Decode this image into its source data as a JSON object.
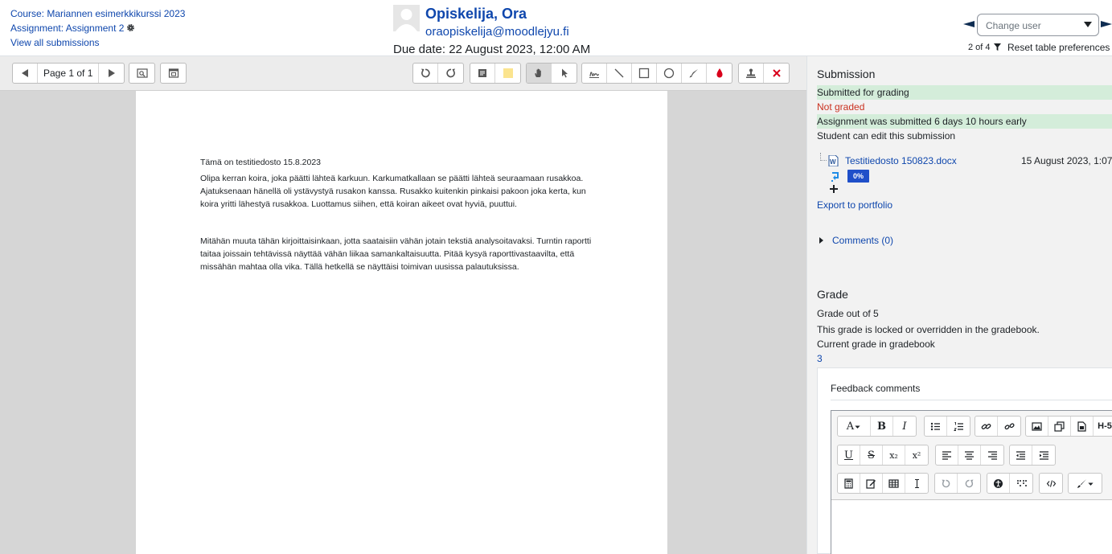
{
  "header": {
    "course": "Course: Mariannen esimerkkikurssi 2023",
    "assignment": "Assignment: Assignment 2",
    "view_all": "View all submissions",
    "user_name": "Opiskelija, Ora",
    "user_email": "oraopiskelija@moodlejyu.fi",
    "due_date": "Due date: 22 August 2023, 12:00 AM",
    "change_user_placeholder": "Change user",
    "user_count": "2 of 4",
    "reset_prefs": "Reset table preferences"
  },
  "toolbar": {
    "page_label": "Page 1 of 1",
    "icons": [
      "previous-page",
      "next-page",
      "search-comments",
      "expand-comments",
      "rotate-left",
      "rotate-right",
      "comment",
      "comment-color",
      "pan",
      "select",
      "pen",
      "line",
      "rectangle",
      "oval",
      "highlight",
      "annotation-color",
      "stamp",
      "delete"
    ]
  },
  "document": {
    "title": "Tämä on testitiedosto 15.8.2023",
    "paragraphs": [
      "Olipa kerran koira, joka päätti lähteä karkuun. Karkumatkallaan se päätti lähteä seuraamaan rusakkoa. Ajatuksenaan hänellä oli ystävystyä rusakon kanssa.  Rusakko kuitenkin pinkaisi pakoon joka kerta, kun koira yritti lähestyä rusakkoa. Luottamus siihen, että koiran aikeet ovat hyviä, puuttui.",
      "Mitähän muuta tähän kirjoittaisinkaan, jotta saataisiin vähän jotain tekstiä analysoitavaksi. Turntin raportti taitaa joissain tehtävissä näyttää vähän liikaa samankaltaisuutta. Pitää kysyä raporttivastaavilta, että missähän mahtaa olla vika. Tällä hetkellä se näyttäisi toimivan uusissa palautuksissa."
    ]
  },
  "submission": {
    "title": "Submission",
    "status_submitted": "Submitted for grading",
    "status_grading": "Not graded",
    "status_time": "Assignment was submitted 6 days 10 hours early",
    "status_edit": "Student can edit this submission",
    "file_name": "Testitiedosto 150823.docx",
    "file_date": "15 August 2023, 1:07",
    "similarity": "0%",
    "export": "Export to portfolio",
    "comments": "Comments (0)"
  },
  "grade": {
    "title": "Grade",
    "out_of": "Grade out of 5",
    "locked": "This grade is locked or overridden in the gradebook.",
    "current_label": "Current grade in gradebook",
    "current_value": "3",
    "feedback_label": "Feedback comments"
  },
  "editor": {
    "font_label": "A",
    "bold_label": "B",
    "italic_label": "I",
    "underline_label": "U",
    "strike_label": "S",
    "subscript_label": "x₂",
    "superscript_label": "x²",
    "heading_label": "H-5"
  },
  "colors": {
    "link": "#0f47ad",
    "success_bg": "#d4edda",
    "danger": "#ca3120",
    "badge": "#1f4fc9"
  }
}
